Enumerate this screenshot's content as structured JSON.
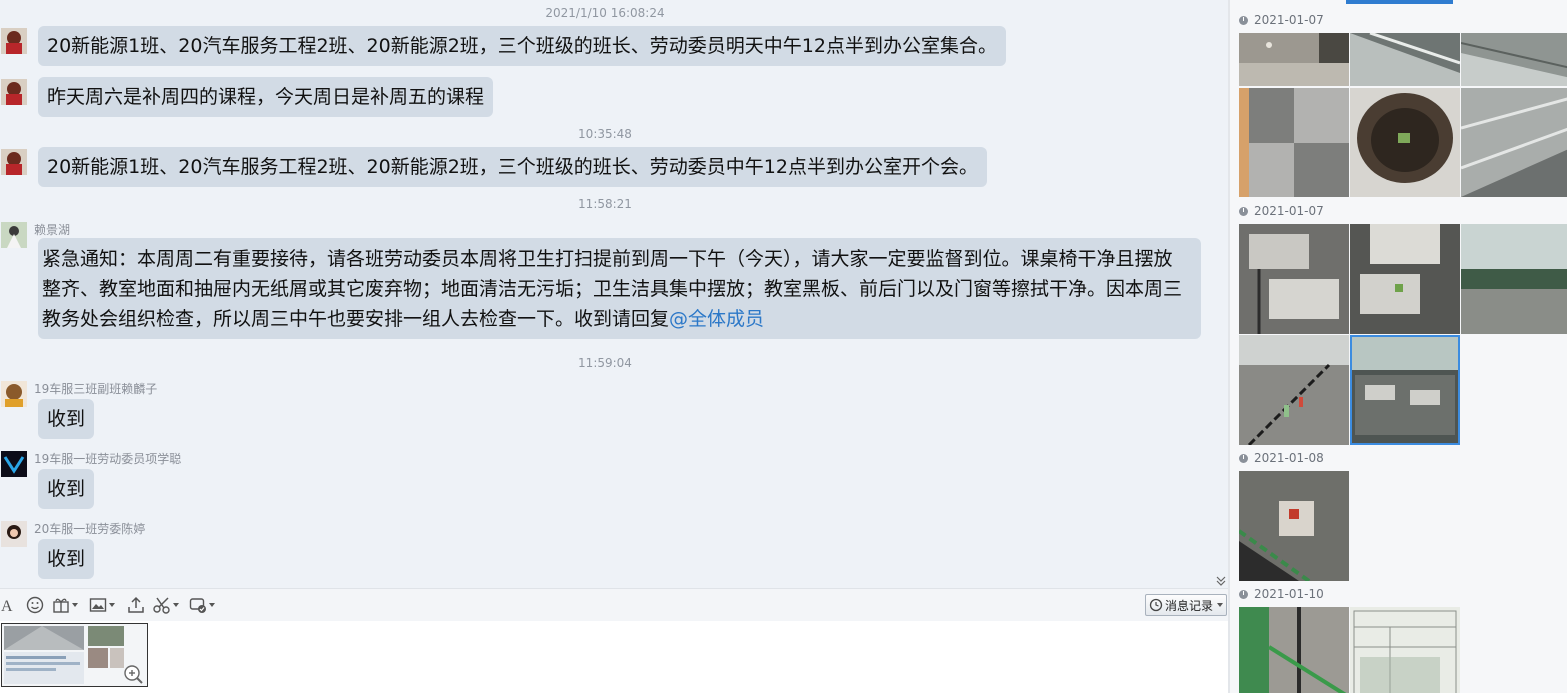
{
  "chat": {
    "messages": [
      {
        "time": "2021/1/10 16:08:24",
        "text": "20新能源1班、20汽车服务工程2班、20新能源2班，三个班级的班长、劳动委员明天中午12点半到办公室集合。"
      },
      {
        "text": "昨天周六是补周四的课程，今天周日是补周五的课程"
      },
      {
        "time": "10:35:48",
        "text": "20新能源1班、20汽车服务工程2班、20新能源2班，三个班级的班长、劳动委员中午12点半到办公室开个会。"
      },
      {
        "time": "11:58:21",
        "sender": "赖景湖",
        "text": "紧急通知：本周周二有重要接待，请各班劳动委员本周将卫生打扫提前到周一下午（今天），请大家一定要监督到位。课桌椅干净且摆放整齐、教室地面和抽屉内无纸屑或其它废弃物；地面清洁无污垢；卫生洁具集中摆放；教室黑板、前后门以及门窗等擦拭干净。因本周三教务处会组织检查，所以周三中午也要安排一组人去检查一下。收到请回复",
        "mention": "@全体成员"
      },
      {
        "time": "11:59:04",
        "sender": "19车服三班副班赖麟子",
        "text": "收到"
      },
      {
        "sender": "19车服一班劳动委员项学聪",
        "text": "收到"
      },
      {
        "sender": "20车服一班劳委陈婷",
        "text": "收到"
      }
    ]
  },
  "toolbar": {
    "icons": [
      "font-icon",
      "emoji-icon",
      "gift-icon",
      "image-icon",
      "upload-icon",
      "scissors-icon",
      "more-icon"
    ],
    "history_label": "消息记录"
  },
  "panel": {
    "groups": [
      {
        "date": "2021-01-07",
        "count": 6
      },
      {
        "date": "2021-01-07",
        "count": 5,
        "selected_index": 4
      },
      {
        "date": "2021-01-08",
        "count": 1
      },
      {
        "date": "2021-01-10",
        "count": 2
      }
    ]
  },
  "colors": {
    "chat_bg": "#eef2f7",
    "bubble": "#d2dbe5",
    "mention": "#2c78c8",
    "selection": "#3c8ce0"
  }
}
